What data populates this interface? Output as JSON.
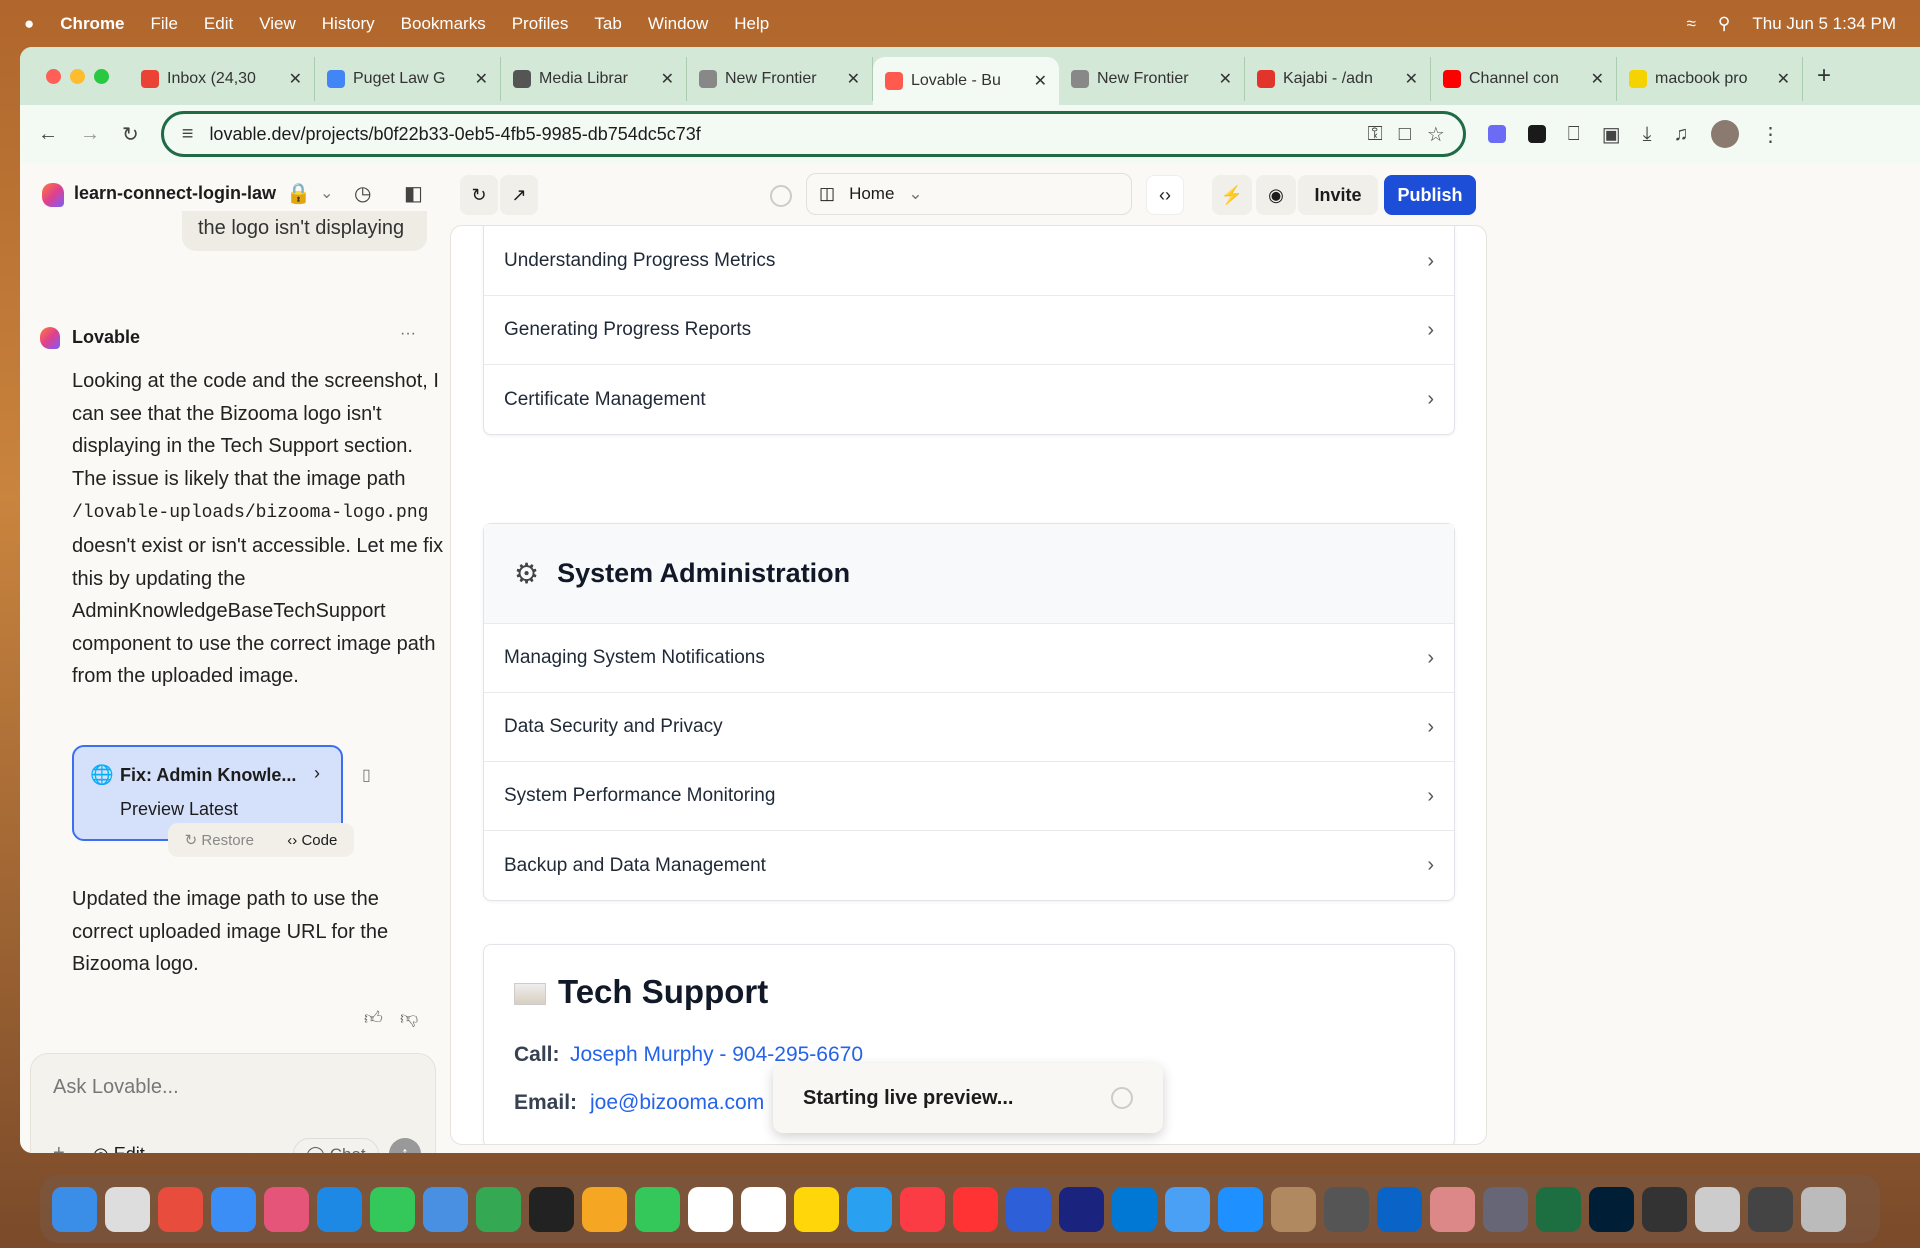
{
  "menubar": {
    "apple": "",
    "app": "Chrome",
    "items": [
      "File",
      "Edit",
      "View",
      "History",
      "Bookmarks",
      "Profiles",
      "Tab",
      "Window",
      "Help"
    ],
    "clock": "Thu Jun 5  1:34 PM"
  },
  "tabs": [
    {
      "label": "Inbox (24,30",
      "color": "#ea4335"
    },
    {
      "label": "Puget Law G",
      "color": "#4285f4"
    },
    {
      "label": "Media Librar",
      "color": "#555555"
    },
    {
      "label": "New Frontier",
      "color": "#888888"
    },
    {
      "label": "Lovable - Bu",
      "color": "#ff5a4e"
    },
    {
      "label": "New Frontier",
      "color": "#888888"
    },
    {
      "label": "Kajabi - /adn",
      "color": "#e2342a"
    },
    {
      "label": "Channel con",
      "color": "#ff0000"
    },
    {
      "label": "macbook pro",
      "color": "#f5d300"
    }
  ],
  "address": {
    "url": "lovable.dev/projects/b0f22b33-0eb5-4fb5-9985-db754dc5c73f"
  },
  "app": {
    "project": "learn-connect-login-law",
    "route": "Home",
    "invite": "Invite",
    "publish": "Publish"
  },
  "chat": {
    "prev_user_snippet": "the logo isn't displaying",
    "author": "Lovable",
    "more": "···",
    "msg1_a": "Looking at the code and the screenshot, I can see that the Bizooma logo isn't displaying in the Tech Support section. The issue is likely that the image path ",
    "msg1_code": "/lovable-uploads/bizooma-logo.png",
    "msg1_b": " doesn't exist or isn't accessible. Let me fix this by updating the AdminKnowledgeBaseTechSupport component to use the correct image path from the uploaded image.",
    "card_title": "Fix: Admin Knowle...",
    "card_sub": "Preview Latest",
    "restore": "Restore",
    "code": "Code",
    "msg2": "Updated the image path to use the correct uploaded image URL for the Bizooma logo.",
    "input_placeholder": "Ask Lovable...",
    "edit": "Edit",
    "chat_btn": "Chat"
  },
  "preview": {
    "section1_rows": [
      "Understanding Progress Metrics",
      "Generating Progress Reports",
      "Certificate Management"
    ],
    "section2_title": "System Administration",
    "section2_rows": [
      "Managing System Notifications",
      "Data Security and Privacy",
      "System Performance Monitoring",
      "Backup and Data Management"
    ],
    "tech_title": "Tech Support",
    "call_label": "Call:",
    "call_value": "Joseph Murphy - 904-295-6670",
    "email_label": "Email:",
    "email_value": "joe@bizooma.com",
    "toast": "Starting live preview..."
  },
  "colors": {
    "accent": "#1d4ed8",
    "link": "#2563eb",
    "card": "#d5e1fb"
  }
}
